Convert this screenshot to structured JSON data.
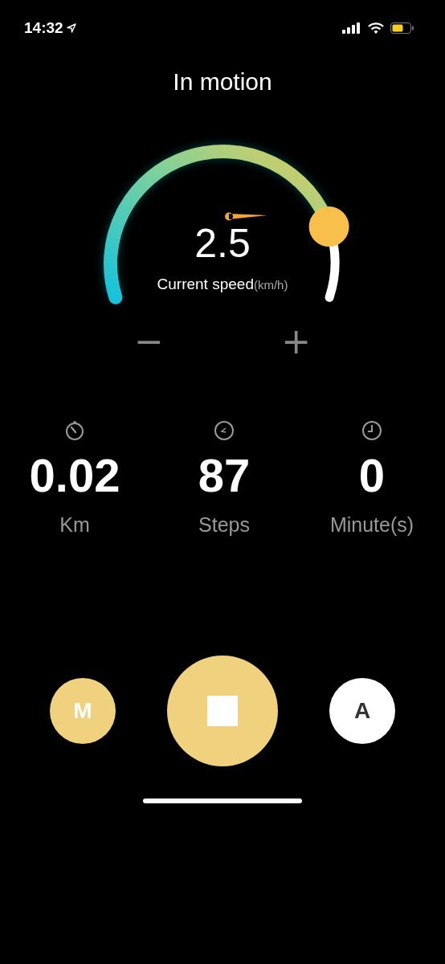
{
  "status_bar": {
    "time": "14:32"
  },
  "title": "In motion",
  "gauge": {
    "value": "2.5",
    "label": "Current speed",
    "unit": "(km/h)"
  },
  "speed_controls": [
    "−",
    "+"
  ],
  "stats": [
    {
      "kind": "distance",
      "value": "0.02",
      "label": "Km"
    },
    {
      "kind": "steps",
      "value": "87",
      "label": "Steps"
    },
    {
      "kind": "time",
      "value": "0",
      "label": "Minute(s)"
    }
  ],
  "buttons": [
    {
      "kind": "mode",
      "label": "M",
      "selected": true
    },
    {
      "kind": "stop"
    },
    {
      "kind": "mode",
      "label": "A",
      "selected": false
    }
  ]
}
